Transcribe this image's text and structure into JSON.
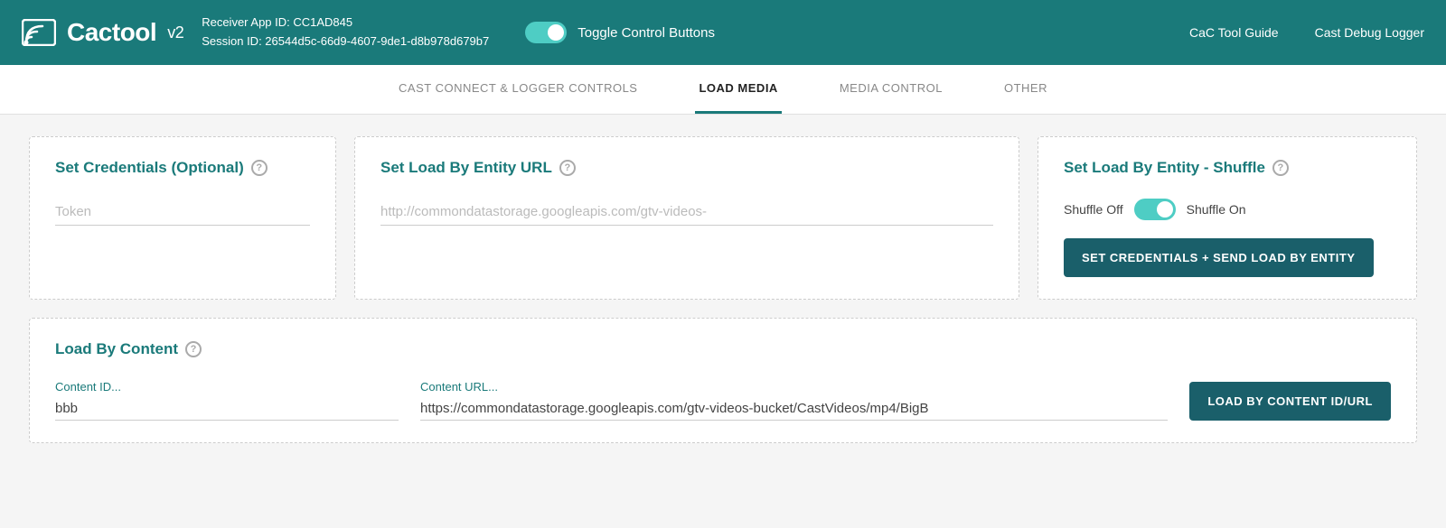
{
  "header": {
    "logo_text": "Cactool",
    "logo_version": "v2",
    "receiver_app_id_label": "Receiver App ID: CC1AD845",
    "session_id_label": "Session ID: 26544d5c-66d9-4607-9de1-d8b978d679b7",
    "toggle_label": "Toggle Control Buttons",
    "nav_items": [
      {
        "label": "CaC Tool Guide"
      },
      {
        "label": "Cast Debug Logger"
      }
    ]
  },
  "tabs": [
    {
      "label": "CAST CONNECT & LOGGER CONTROLS",
      "active": false
    },
    {
      "label": "LOAD MEDIA",
      "active": true
    },
    {
      "label": "MEDIA CONTROL",
      "active": false
    },
    {
      "label": "OTHER",
      "active": false
    }
  ],
  "load_media": {
    "set_credentials": {
      "title": "Set Credentials (Optional)",
      "token_placeholder": "Token"
    },
    "set_load_entity_url": {
      "title": "Set Load By Entity URL",
      "url_placeholder": "http://commondatastorage.googleapis.com/gtv-videos-"
    },
    "set_load_entity_shuffle": {
      "title": "Set Load By Entity - Shuffle",
      "shuffle_off_label": "Shuffle Off",
      "shuffle_on_label": "Shuffle On",
      "button_label": "SET CREDENTIALS + SEND LOAD BY ENTITY"
    },
    "load_by_content": {
      "title": "Load By Content",
      "content_id_label": "Content ID...",
      "content_id_value": "bbb",
      "content_url_label": "Content URL...",
      "content_url_value": "https://commondatastorage.googleapis.com/gtv-videos-bucket/CastVideos/mp4/BigB",
      "button_label": "LOAD BY CONTENT ID/URL"
    }
  }
}
